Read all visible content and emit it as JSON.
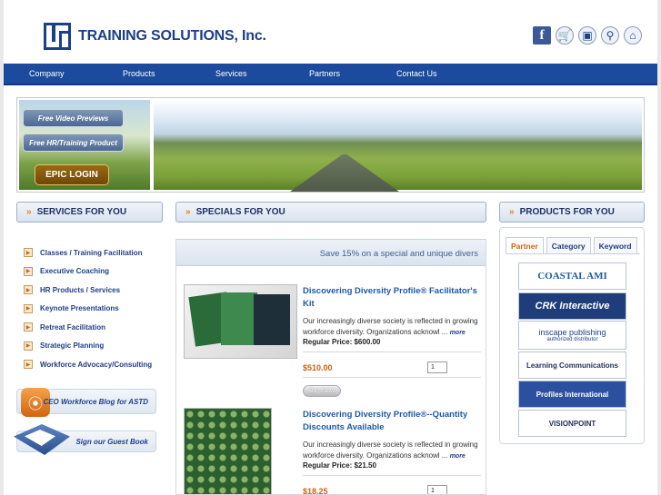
{
  "brand": {
    "name": "TRAINING SOLUTIONS, Inc."
  },
  "header_icons": [
    "facebook-icon",
    "cart-icon",
    "chart-icon",
    "search-icon",
    "home-icon"
  ],
  "nav": [
    "Company",
    "Products",
    "Services",
    "Partners",
    "Contact Us"
  ],
  "hero": {
    "btn1": "Free Video Previews",
    "btn2": "Free HR/Training Product",
    "login": "EPIC LOGIN"
  },
  "services": {
    "title": "SERVICES FOR YOU",
    "items": [
      "Classes / Training Facilitation",
      "Executive Coaching",
      "HR Products / Services",
      "Keynote Presentations",
      "Retreat Facilitation",
      "Strategic Planning",
      "Workforce Advocacy/Consulting"
    ]
  },
  "blog": "CEO Workforce Blog for ASTD",
  "guestbook": "Sign our Guest Book",
  "specials": {
    "title": "SPECIALS FOR YOU",
    "marquee": "Save 15% on a special and unique divers",
    "products": [
      {
        "title": "Discovering Diversity Profile® Facilitator's Kit",
        "desc": "Our increasingly diverse society is reflected in growing workforce diversity. Organizations acknowl ...",
        "more": "more",
        "regular": "Regular Price: $600.00",
        "price": "$510.00",
        "qty": "1",
        "buy": "Buy Now"
      },
      {
        "title": "Discovering Diversity Profile®--Quantity Discounts Available",
        "desc": "Our increasingly diverse society is reflected in growing workforce diversity. Organizations acknowl ...",
        "more": "more",
        "regular": "Regular Price: $21.50",
        "price": "$18.25",
        "qty": "1"
      }
    ]
  },
  "products": {
    "title": "PRODUCTS FOR YOU",
    "tabs": [
      "Partner",
      "Category",
      "Keyword"
    ],
    "partners": [
      "COASTAL AMI",
      "CRK Interactive",
      "inscape publishing",
      "Learning Communications",
      "Profiles International",
      "VISIONPOINT"
    ],
    "inscape_sub": "authorized distributor"
  }
}
